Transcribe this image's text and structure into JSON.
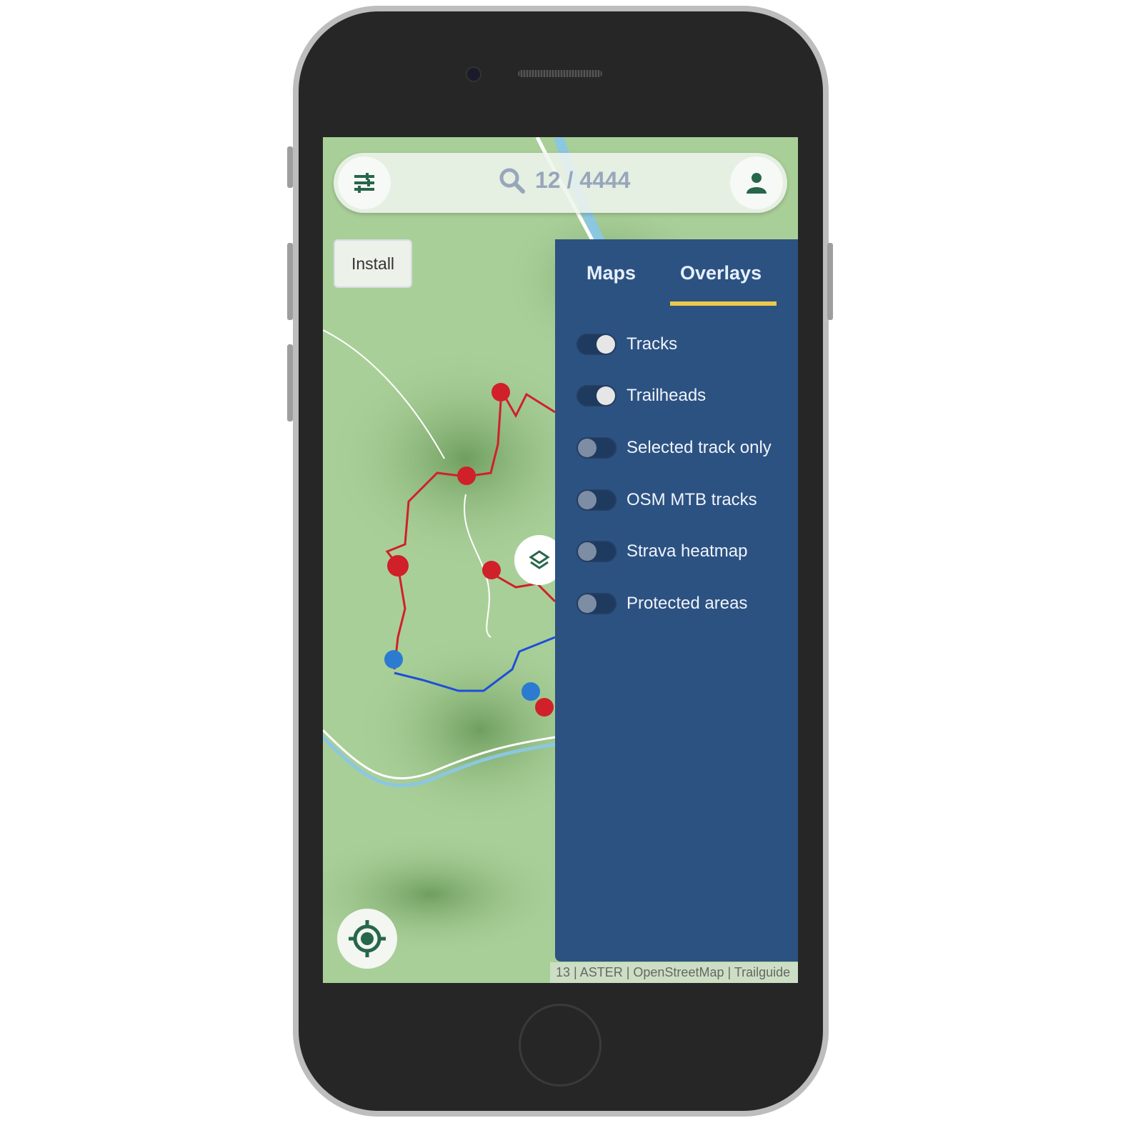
{
  "topbar": {
    "search_text": "12 / 4444",
    "filter_icon": "sliders-icon",
    "search_icon": "search-icon",
    "user_icon": "user-icon"
  },
  "install_label": "Install",
  "panel": {
    "tabs": [
      {
        "label": "Maps",
        "active": false
      },
      {
        "label": "Overlays",
        "active": true
      }
    ],
    "overlays": [
      {
        "label": "Tracks",
        "on": true
      },
      {
        "label": "Trailheads",
        "on": true
      },
      {
        "label": "Selected track only",
        "on": false
      },
      {
        "label": "OSM MTB tracks",
        "on": false
      },
      {
        "label": "Strava heatmap",
        "on": false
      },
      {
        "label": "Protected areas",
        "on": false
      }
    ]
  },
  "attribution": "13 | ASTER | OpenStreetMap | Trailguide",
  "colors": {
    "panel": "#2c5282",
    "accent": "#ecc94b",
    "icon_green": "#276749",
    "track_red": "#d0202a",
    "track_blue": "#1e4fd8"
  }
}
